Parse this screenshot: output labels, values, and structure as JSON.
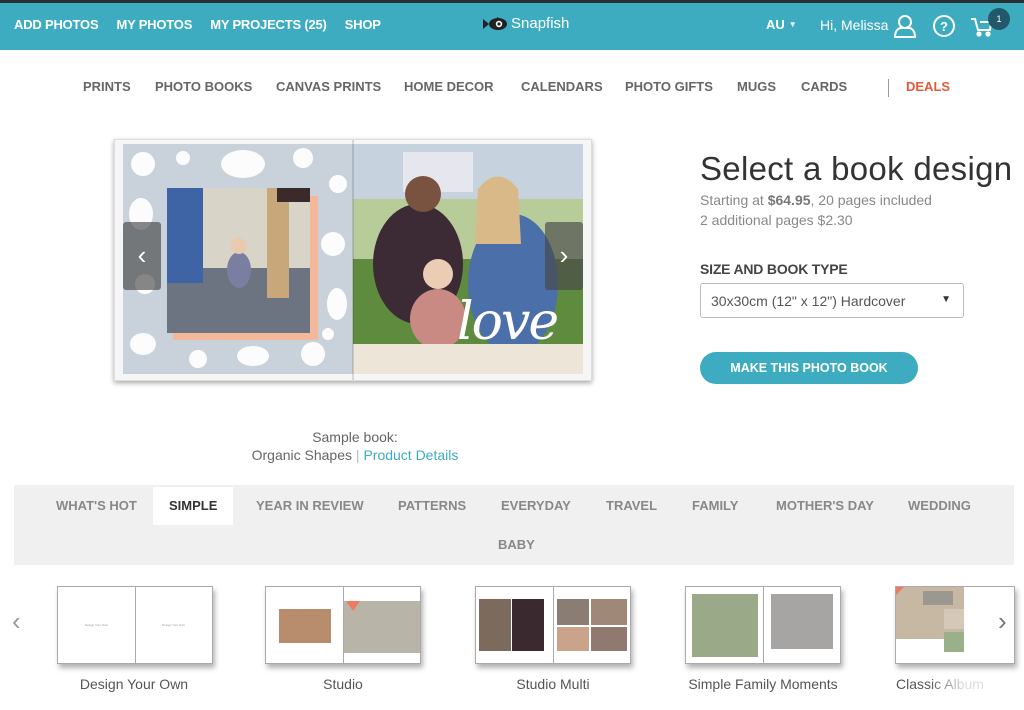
{
  "topbar": {
    "nav": [
      "ADD PHOTOS",
      "MY PHOTOS",
      "MY PROJECTS (25)",
      "SHOP"
    ],
    "logo_text": "Snapfish",
    "region": "AU",
    "greeting": "Hi, Melissa",
    "cart_count": "1",
    "icons": [
      "fish-logo-icon",
      "user-icon",
      "help-icon",
      "cart-icon"
    ],
    "brand_color": "#3eacc0"
  },
  "catnav": {
    "items": [
      "PRINTS",
      "PHOTO BOOKS",
      "CANVAS PRINTS",
      "HOME DECOR",
      "CALENDARS",
      "PHOTO GIFTS",
      "MUGS",
      "CARDS"
    ],
    "deals": "DEALS",
    "deals_color": "#e4593a"
  },
  "hero": {
    "prev_label": "‹",
    "next_label": "›",
    "overlay_text": "love"
  },
  "panel": {
    "title": "Select a book design",
    "starting_prefix": "Starting at ",
    "starting_price": "$64.95",
    "starting_suffix": ", 20 pages included",
    "additional": "2 additional pages $2.30",
    "size_label": "SIZE AND BOOK TYPE",
    "size_value": "30x30cm (12\" x 12\") Hardcover",
    "cta": "MAKE THIS PHOTO BOOK"
  },
  "sample": {
    "label": "Sample book:",
    "name": "Organic Shapes",
    "separator": "|",
    "link": "Product Details"
  },
  "tabs": {
    "items": [
      "WHAT'S HOT",
      "SIMPLE",
      "YEAR IN REVIEW",
      "PATTERNS",
      "EVERYDAY",
      "TRAVEL",
      "FAMILY",
      "MOTHER'S DAY",
      "WEDDING",
      "BABY"
    ],
    "active": "SIMPLE"
  },
  "designs": {
    "items": [
      "Design Your Own",
      "Studio",
      "Studio Multi",
      "Simple Family Moments",
      "Classic Album"
    ],
    "placeholder_text": "Design Your Own",
    "prev_label": "‹",
    "next_label": "›"
  }
}
